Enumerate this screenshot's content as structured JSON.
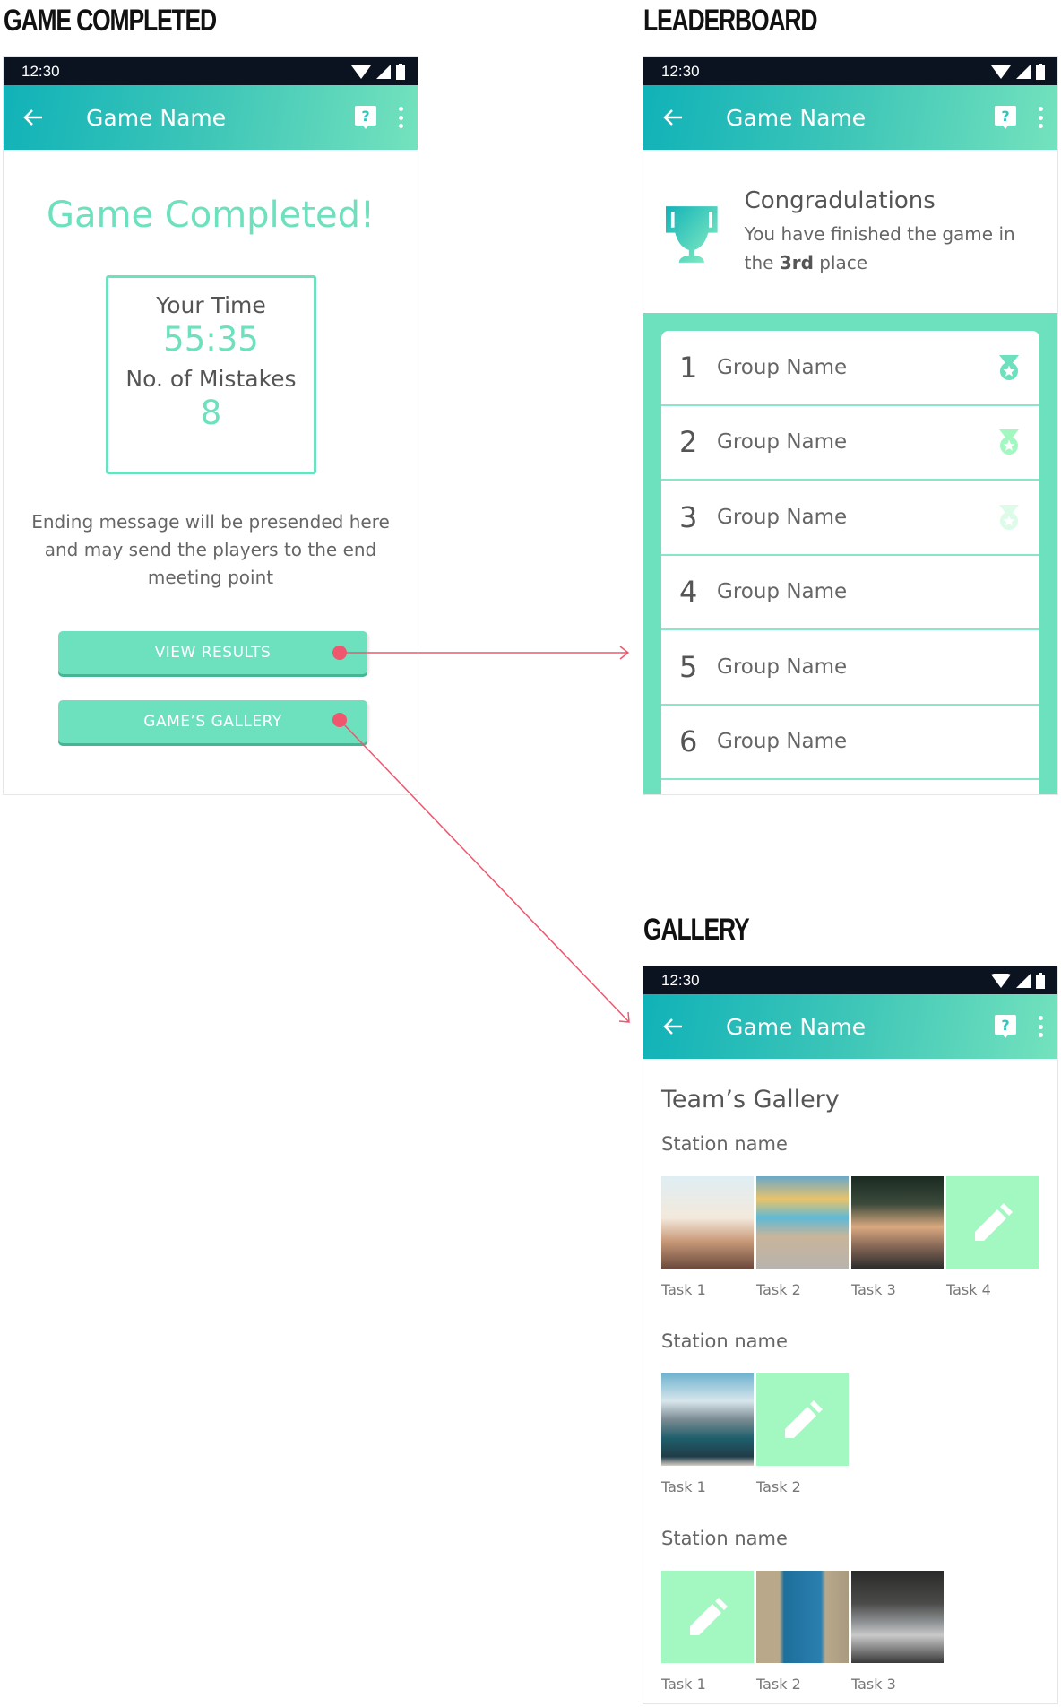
{
  "sections": {
    "game_completed": "GAME COMPLETED",
    "leaderboard": "LEADERBOARD",
    "gallery": "GALLERY"
  },
  "status_bar": {
    "time": "12:30"
  },
  "app_bar": {
    "title": "Game Name"
  },
  "game_completed": {
    "heading": "Game Completed!",
    "time_label": "Your Time",
    "time_value": "55:35",
    "mistakes_label": "No. of Mistakes",
    "mistakes_value": "8",
    "ending_message": "Ending message will be presended here and may send the players to the end meeting point",
    "view_results_button": "VIEW RESULTS",
    "gallery_button": "GAME’S GALLERY"
  },
  "leaderboard": {
    "congrats_title": "Congradulations",
    "congrats_prefix": "You have finished the game in the ",
    "congrats_place": "3rd",
    "congrats_suffix": " place",
    "rows": [
      {
        "rank": "1",
        "name": "Group Name",
        "medal": "gold"
      },
      {
        "rank": "2",
        "name": "Group Name",
        "medal": "silver"
      },
      {
        "rank": "3",
        "name": "Group Name",
        "medal": "bronze"
      },
      {
        "rank": "4",
        "name": "Group Name"
      },
      {
        "rank": "5",
        "name": "Group Name"
      },
      {
        "rank": "6",
        "name": "Group Name"
      }
    ],
    "medal_colors": {
      "gold": "#6de0bd",
      "silver": "#a3f7c1",
      "bronze": "#dcfbe8"
    }
  },
  "gallery": {
    "title": "Team’s Gallery",
    "stations": [
      {
        "name": "Station name",
        "tasks": [
          {
            "label": "Task 1",
            "type": "photo",
            "photo": "beach-people-flag"
          },
          {
            "label": "Task 2",
            "type": "photo",
            "photo": "boardwalk-bicycle"
          },
          {
            "label": "Task 3",
            "type": "photo",
            "photo": "ice-cream-cones"
          },
          {
            "label": "Task 4",
            "type": "edit"
          }
        ]
      },
      {
        "name": "Station name",
        "tasks": [
          {
            "label": "Task 1",
            "type": "photo",
            "photo": "harbor-boats"
          },
          {
            "label": "Task 2",
            "type": "edit"
          }
        ]
      },
      {
        "name": "Station name",
        "tasks": [
          {
            "label": "Task 1",
            "type": "edit"
          },
          {
            "label": "Task 2",
            "type": "photo",
            "photo": "blue-door"
          },
          {
            "label": "Task 3",
            "type": "photo",
            "photo": "cafe-men"
          }
        ]
      }
    ]
  },
  "colors": {
    "accent": "#6de0bd",
    "accent_light": "#a3f7c1",
    "arrow": "#f0566e",
    "status_bar": "#0b1220"
  }
}
